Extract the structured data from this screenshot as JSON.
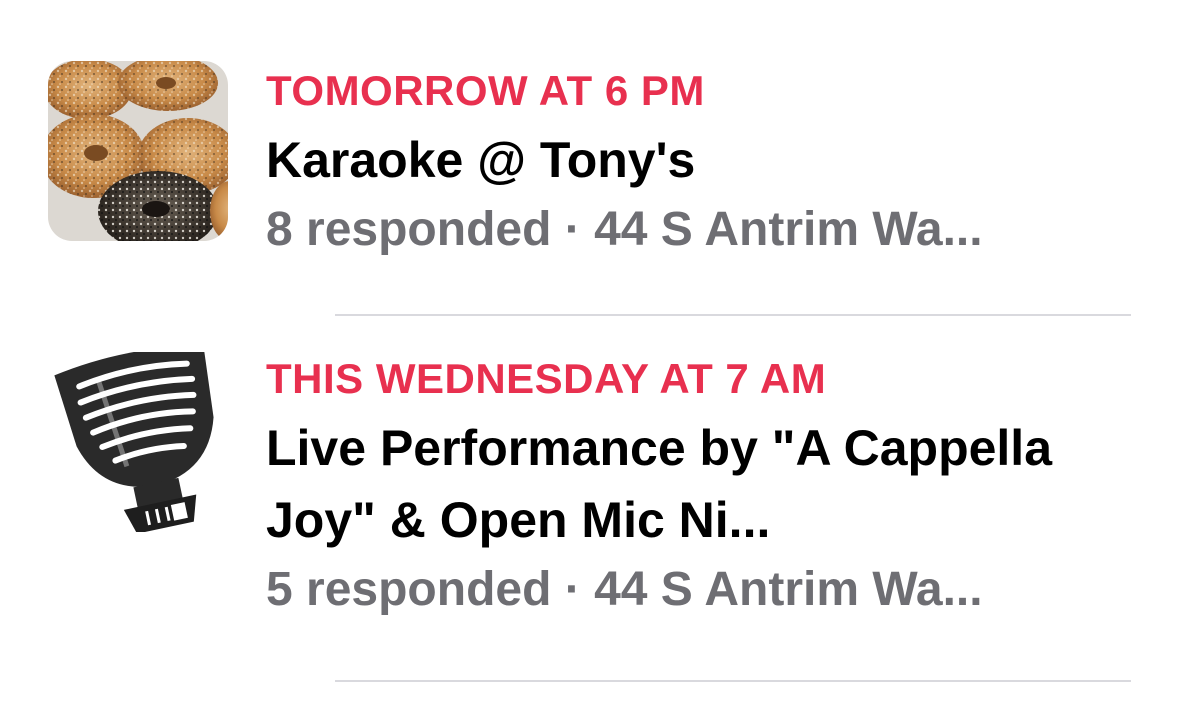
{
  "colors": {
    "accent": "#e8304f",
    "title": "#000000",
    "secondary": "#6e6e73",
    "divider": "#d9d9de"
  },
  "events": [
    {
      "when": "TOMORROW AT 6 PM",
      "title": "Karaoke @ Tony's",
      "responded": "8 responded",
      "separator": "·",
      "location": "44 S Antrim Wa...",
      "image_icon": "bagels-photo"
    },
    {
      "when": "THIS WEDNESDAY AT 7 AM",
      "title": "Live Performance by \"A Cappella Joy\" & Open Mic Ni...",
      "responded": "5 responded",
      "separator": "·",
      "location": "44 S Antrim Wa...",
      "image_icon": "microphone-image"
    }
  ]
}
